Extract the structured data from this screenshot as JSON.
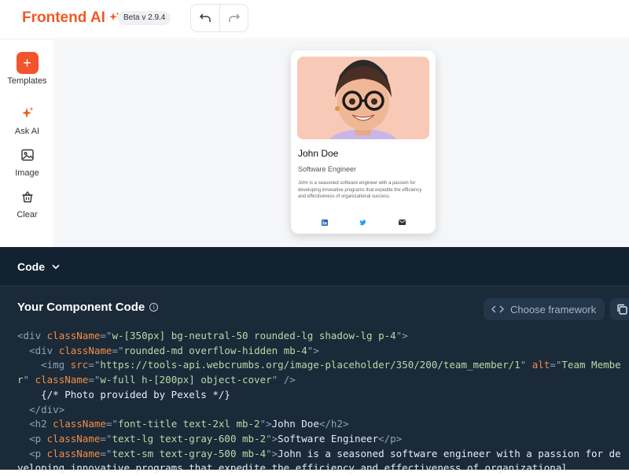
{
  "header": {
    "logo_text": "Frontend AI",
    "version_badge": "Beta v 2.9.4"
  },
  "sidebar": {
    "items": [
      {
        "label": "Templates",
        "icon": "plus-icon"
      },
      {
        "label": "Ask AI",
        "icon": "sparkle-icon"
      },
      {
        "label": "Image",
        "icon": "image-icon"
      },
      {
        "label": "Clear",
        "icon": "trash-icon"
      }
    ]
  },
  "preview_card": {
    "name": "John Doe",
    "title": "Software Engineer",
    "bio": "John is a seasoned software engineer with a passion for developing innovative programs that expedite the efficiency and effectiveness of organizational success.",
    "socials": [
      "linkedin-icon",
      "twitter-icon",
      "email-icon"
    ]
  },
  "code_panel": {
    "toggle_label": "Code",
    "component_title": "Your Component Code",
    "framework_button": "Choose framework",
    "lines": [
      [
        [
          "t",
          "<div "
        ],
        [
          "a",
          "className"
        ],
        [
          "p",
          "=\""
        ],
        [
          "s",
          "w-[350px] bg-neutral-50 rounded-lg shadow-lg p-4"
        ],
        [
          "p",
          "\">"
        ]
      ],
      [
        [
          "t",
          "  <div "
        ],
        [
          "a",
          "className"
        ],
        [
          "p",
          "=\""
        ],
        [
          "s",
          "rounded-md overflow-hidden mb-4"
        ],
        [
          "p",
          "\">"
        ]
      ],
      [
        [
          "t",
          "    <img "
        ],
        [
          "a",
          "src"
        ],
        [
          "p",
          "=\""
        ],
        [
          "s",
          "https://tools-api.webcrumbs.org/image-placeholder/350/200/team_member/1"
        ],
        [
          "p",
          "\" "
        ],
        [
          "a",
          "alt"
        ],
        [
          "p",
          "=\""
        ],
        [
          "s",
          "Team Member"
        ],
        [
          "p",
          "\" "
        ],
        [
          "a",
          "className"
        ],
        [
          "p",
          "=\""
        ],
        [
          "s",
          "w-full h-[200px] object-cover"
        ],
        [
          "p",
          "\" />"
        ]
      ],
      [
        [
          "",
          "    {/* Photo provided by Pexels */}"
        ]
      ],
      [
        [
          "t",
          "  </div>"
        ]
      ],
      [
        [
          "t",
          "  <h2 "
        ],
        [
          "a",
          "className"
        ],
        [
          "p",
          "=\""
        ],
        [
          "s",
          "font-title text-2xl mb-2"
        ],
        [
          "p",
          "\">"
        ],
        [
          "",
          "John Doe"
        ],
        [
          "t",
          "</h2>"
        ]
      ],
      [
        [
          "t",
          "  <p "
        ],
        [
          "a",
          "className"
        ],
        [
          "p",
          "=\""
        ],
        [
          "s",
          "text-lg text-gray-600 mb-2"
        ],
        [
          "p",
          "\">"
        ],
        [
          "",
          "Software Engineer"
        ],
        [
          "t",
          "</p>"
        ]
      ],
      [
        [
          "t",
          "  <p "
        ],
        [
          "a",
          "className"
        ],
        [
          "p",
          "=\""
        ],
        [
          "s",
          "text-sm text-gray-500 mb-4"
        ],
        [
          "p",
          "\">"
        ],
        [
          "",
          "John is a seasoned software engineer with a passion for developing innovative programs that expedite the efficiency and effectiveness of organizational"
        ]
      ]
    ]
  },
  "colors": {
    "brand": "#ef5a24",
    "code_bg": "#1b2a38"
  }
}
